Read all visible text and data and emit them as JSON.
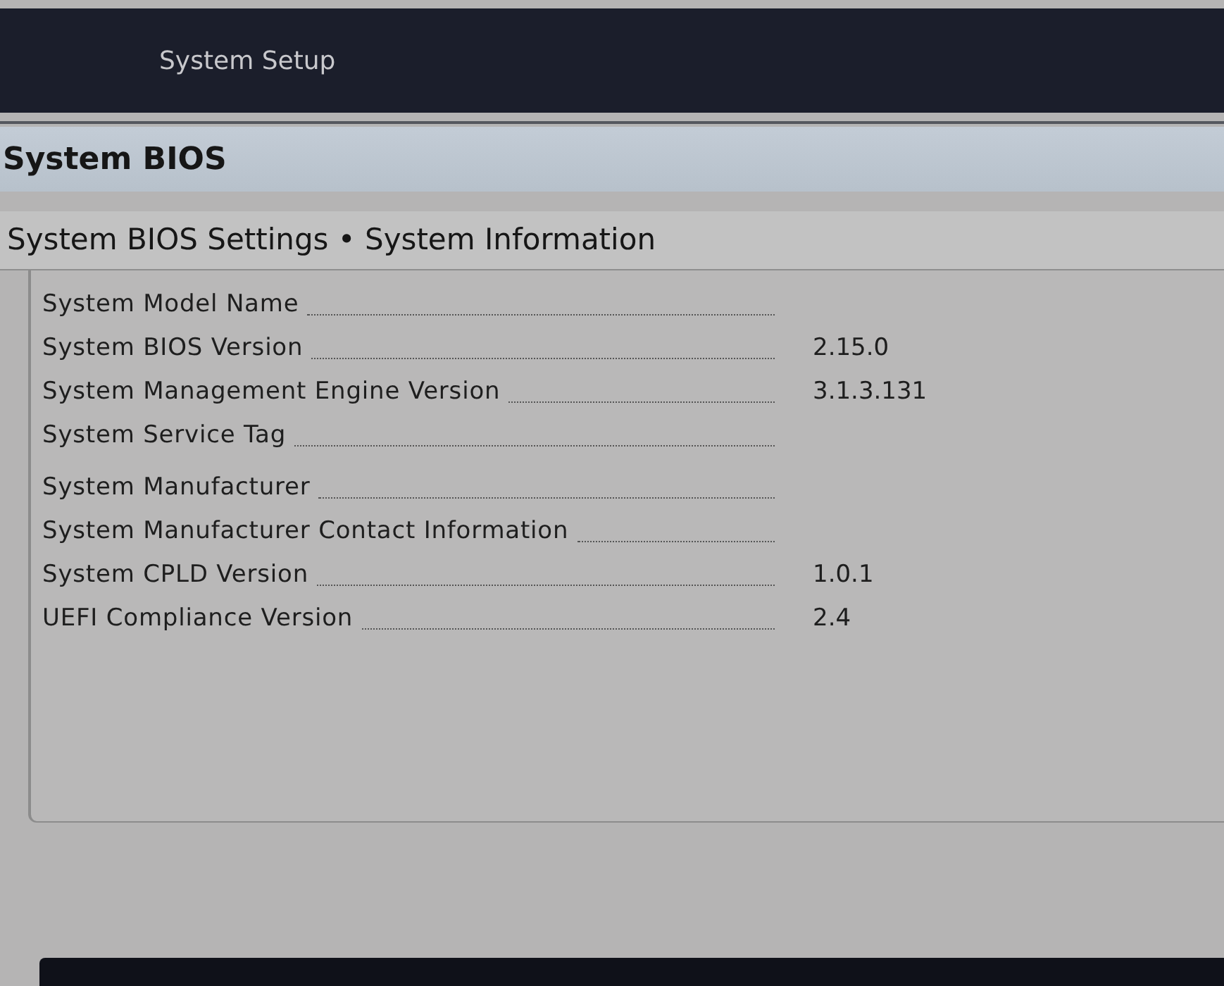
{
  "header": {
    "title": "System Setup"
  },
  "page": {
    "title": "System BIOS"
  },
  "section": {
    "title": "System BIOS Settings • System Information"
  },
  "fields": [
    {
      "label": "System Model Name"
    },
    {
      "label": "System BIOS Version",
      "value": "2.15.0"
    },
    {
      "label": "System Management Engine Version",
      "value": "3.1.3.131"
    },
    {
      "label": "System Service Tag"
    },
    {
      "label": "System Manufacturer"
    },
    {
      "label": "System Manufacturer Contact Information"
    },
    {
      "label": "System CPLD Version",
      "value": "1.0.1"
    },
    {
      "label": "UEFI Compliance Version",
      "value": "2.4"
    }
  ]
}
